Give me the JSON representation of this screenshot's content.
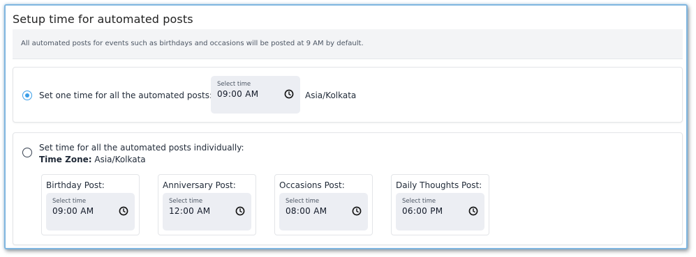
{
  "header": {
    "title": "Setup time for automated posts",
    "info": "All automated posts for events such as birthdays and occasions will be posted at 9 AM by default."
  },
  "option_single": {
    "selected": true,
    "label": "Set one time for all the automated posts:",
    "time_caption": "Select time",
    "time_value": "09:00 AM",
    "timezone": "Asia/Kolkata"
  },
  "option_individual": {
    "selected": false,
    "label": "Set time for all the automated posts individually:",
    "tz_label": "Time Zone:",
    "tz_value": "Asia/Kolkata",
    "posts": [
      {
        "title": "Birthday Post:",
        "caption": "Select time",
        "time": "09:00 AM"
      },
      {
        "title": "Anniversary Post:",
        "caption": "Select time",
        "time": "12:00 AM"
      },
      {
        "title": "Occasions Post:",
        "caption": "Select time",
        "time": "08:00 AM"
      },
      {
        "title": "Daily Thoughts Post:",
        "caption": "Select time",
        "time": "06:00 PM"
      }
    ]
  },
  "colors": {
    "accent": "#3b9ee8",
    "frame_border": "#7fb6e0",
    "time_box_bg": "#eceef3",
    "info_bg": "#f3f4f6"
  },
  "icons": {
    "clock": "clock-icon"
  }
}
